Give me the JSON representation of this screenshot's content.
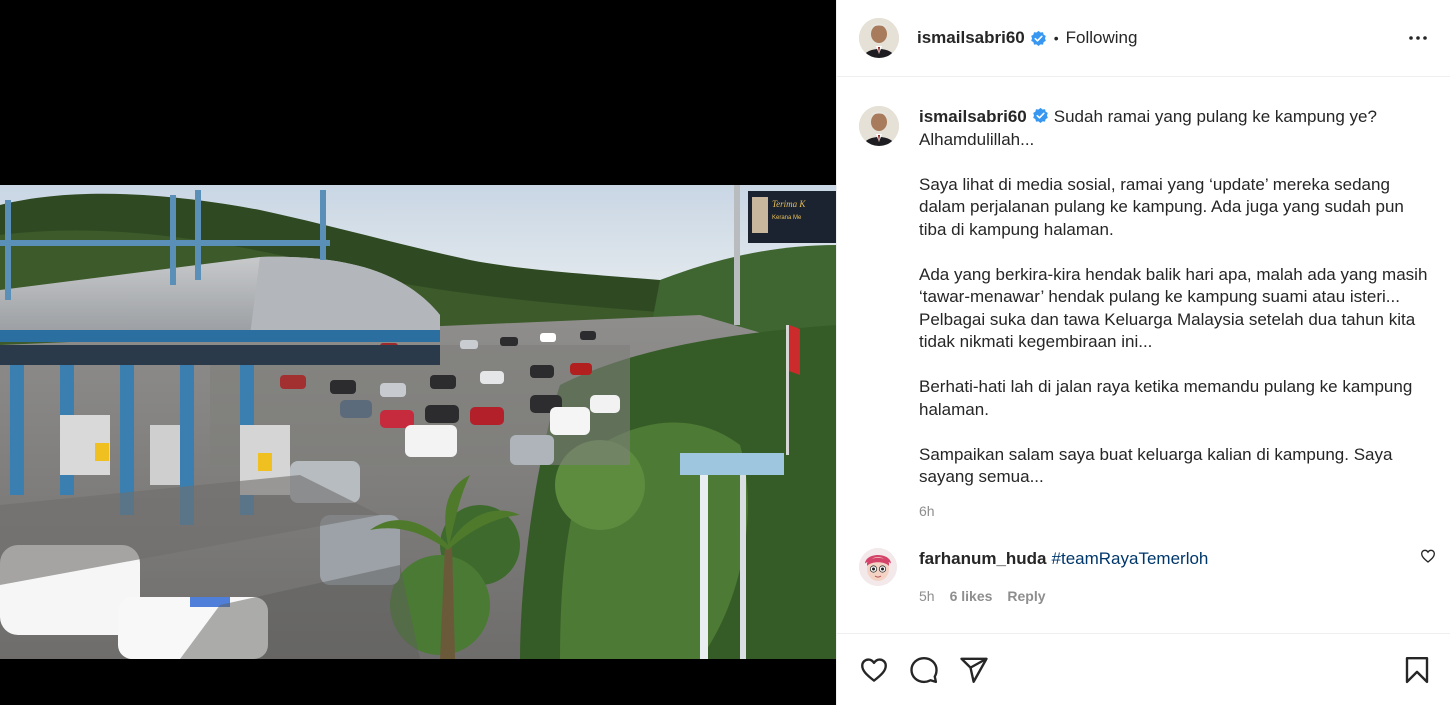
{
  "post": {
    "username": "ismailsabri60",
    "verified": true,
    "follow_status": "Following",
    "separator": "•"
  },
  "caption": {
    "username": "ismailsabri60",
    "text": "Sudah ramai yang pulang ke kampung ye? Alhamdulillah...\n\nSaya lihat di media sosial, ramai yang ‘update’ mereka sedang dalam perjalanan pulang ke kampung. Ada juga yang sudah pun tiba di kampung halaman.\n\nAda yang berkira-kira hendak balik hari apa, malah ada yang masih ‘tawar-menawar’ hendak pulang ke kampung suami atau isteri... Pelbagai suka dan tawa Keluarga Malaysia setelah dua tahun kita tidak nikmati kegembiraan ini...\n\nBerhati-hati lah di jalan raya ketika memandu pulang ke kampung halaman.\n\nSampaikan salam saya buat keluarga kalian di kampung. Saya sayang semua...",
    "time": "6h"
  },
  "comments": [
    {
      "username": "farhanum_huda",
      "text": "#teamRayaTemerloh",
      "time": "5h",
      "likes": "6 likes",
      "reply_label": "Reply"
    }
  ],
  "billboard": {
    "line1": "Terima K",
    "line2": "Kerana Me"
  },
  "icons": {
    "more": "more-horizontal-icon",
    "verified": "verified-badge-icon",
    "like": "heart-icon",
    "comment": "comment-bubble-icon",
    "share": "paper-plane-icon",
    "save": "bookmark-icon",
    "comment_like": "small-heart-icon"
  },
  "colors": {
    "verified_blue": "#3897f0",
    "hashtag": "#00376b",
    "muted": "#8e8e8e",
    "text": "#262626"
  }
}
